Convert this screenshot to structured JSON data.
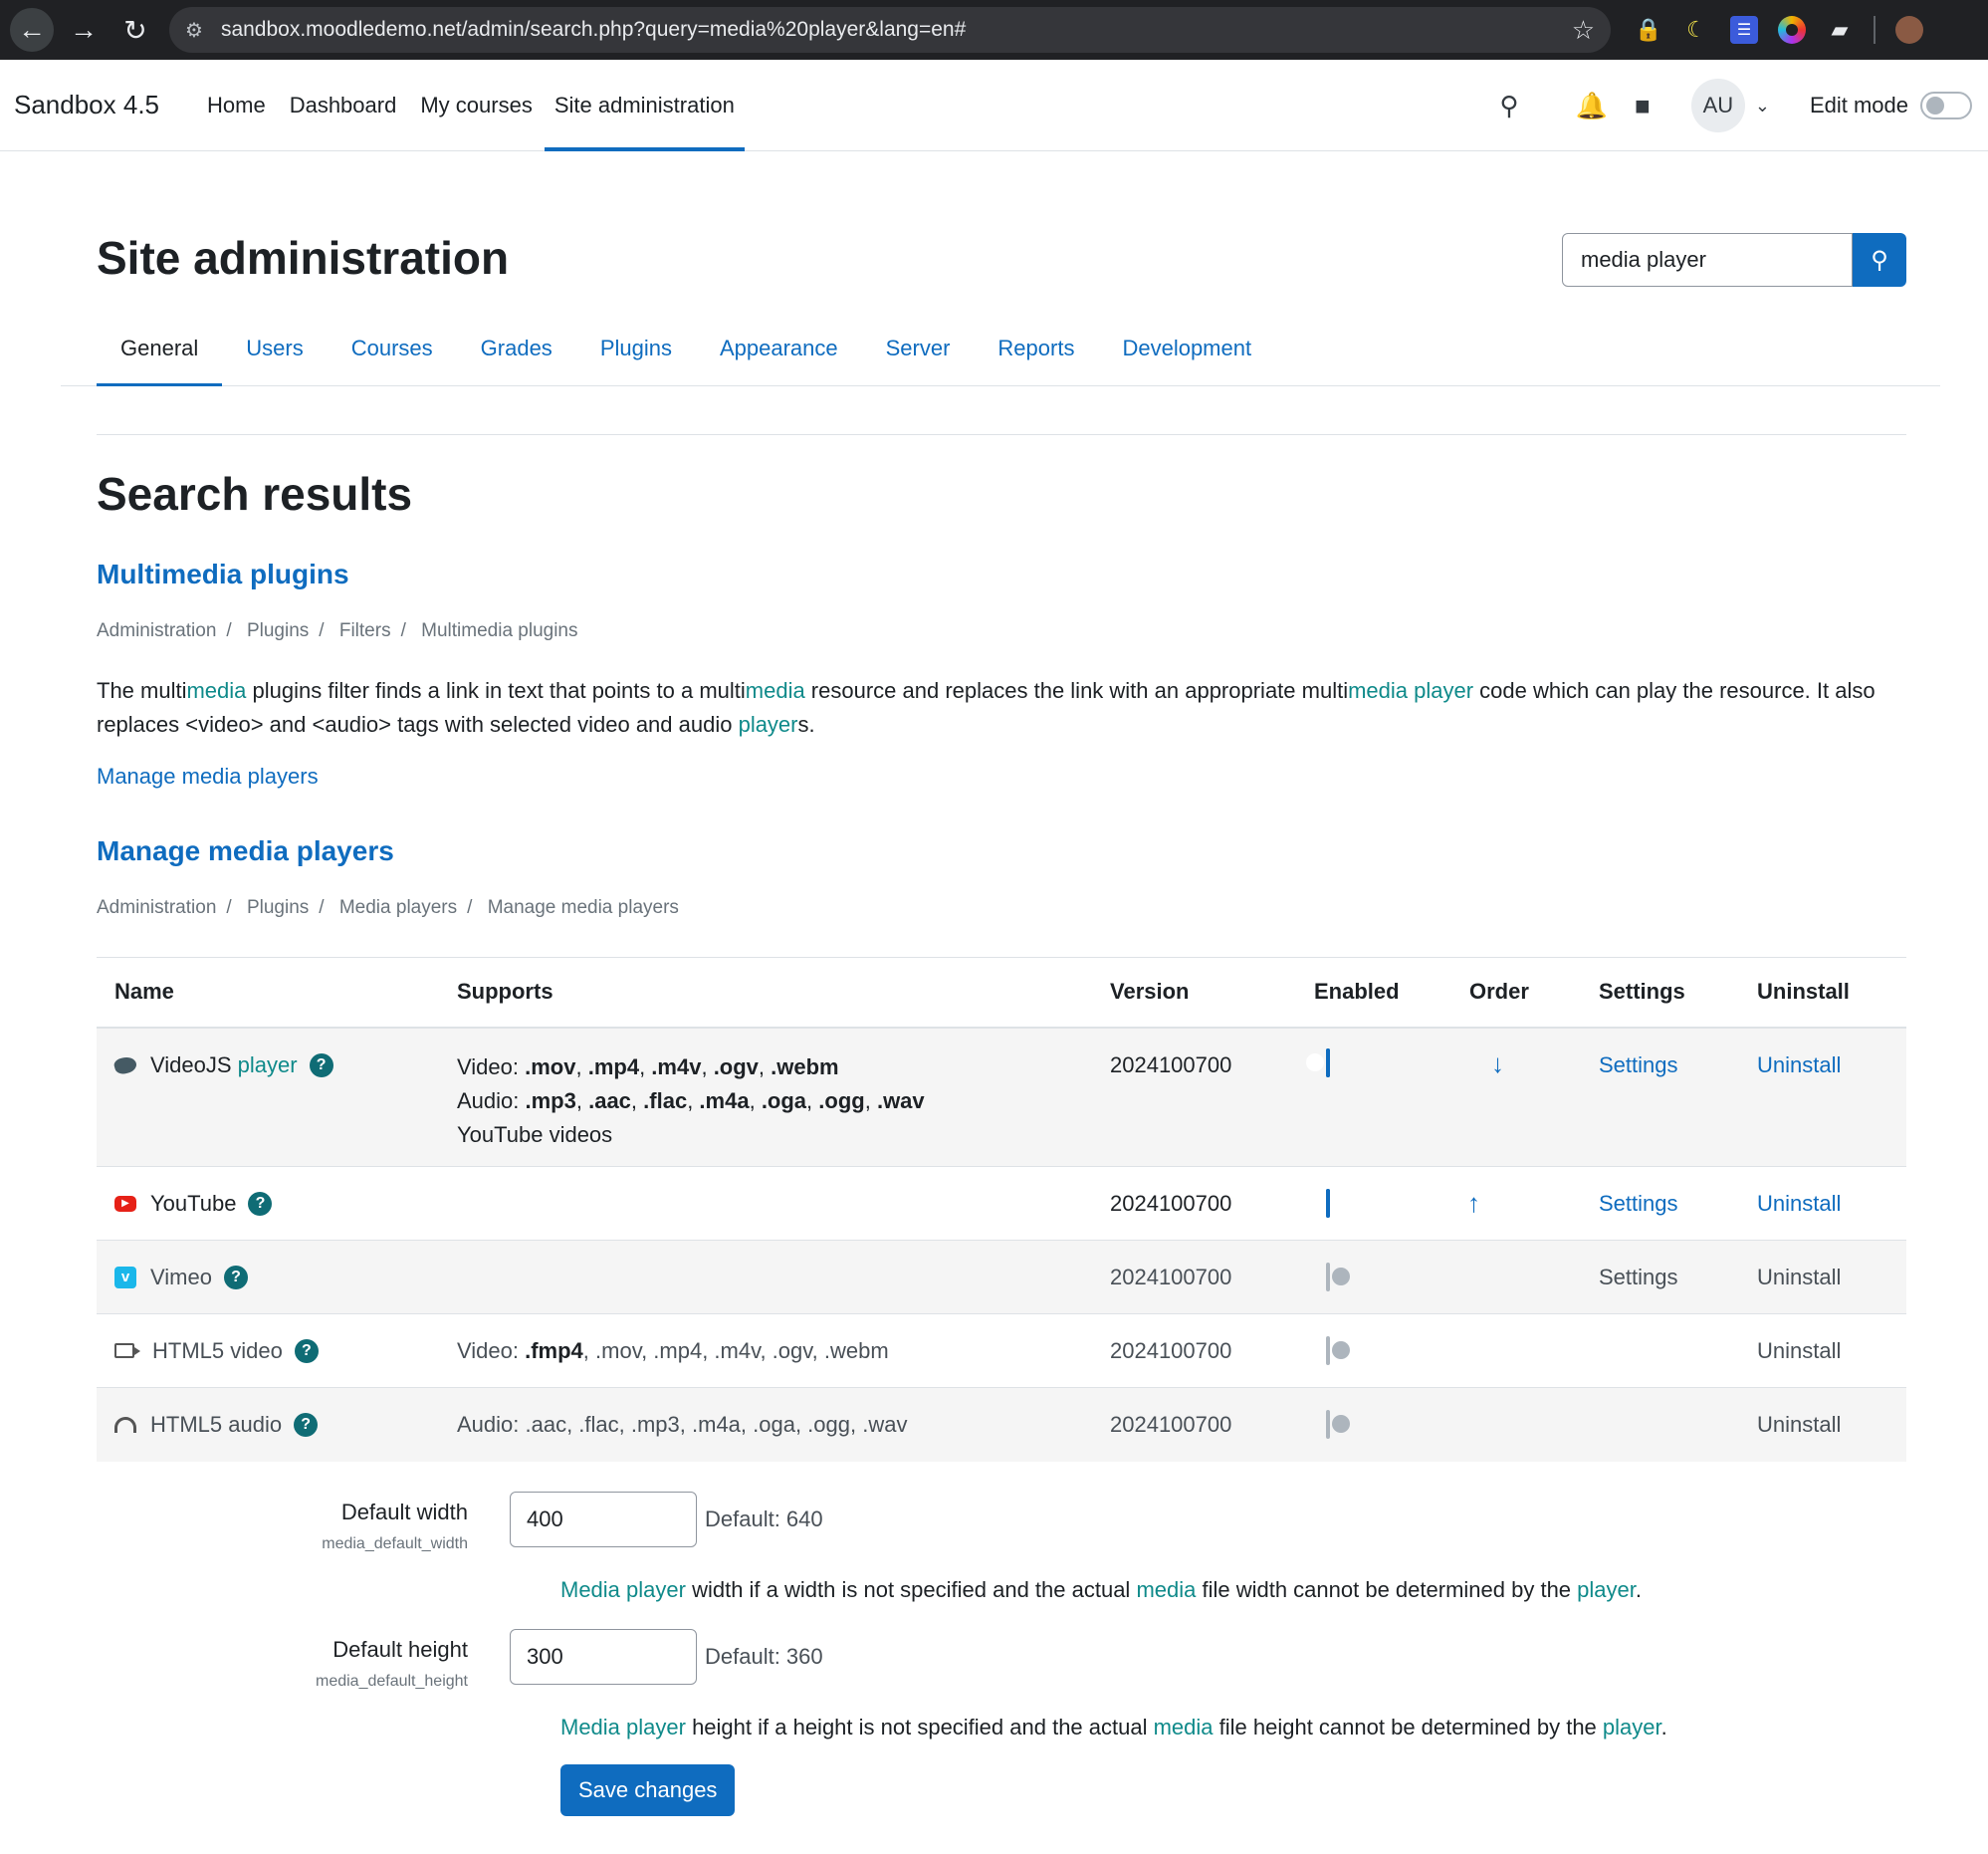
{
  "browser": {
    "url": "sandbox.moodledemo.net/admin/search.php?query=media%20player&lang=en#"
  },
  "navbar": {
    "brand": "Sandbox 4.5",
    "items": [
      "Home",
      "Dashboard",
      "My courses",
      "Site administration"
    ],
    "active_item": "Site administration",
    "user_initials": "AU",
    "edit_mode_label": "Edit mode"
  },
  "page": {
    "title": "Site administration",
    "search_value": "media player",
    "tabs": [
      "General",
      "Users",
      "Courses",
      "Grades",
      "Plugins",
      "Appearance",
      "Server",
      "Reports",
      "Development"
    ],
    "active_tab": "General",
    "results_heading": "Search results"
  },
  "multimedia_section": {
    "heading": "Multimedia plugins",
    "breadcrumb": [
      "Administration",
      "Plugins",
      "Filters",
      "Multimedia plugins"
    ],
    "desc": {
      "t1": "The multi",
      "h1": "media",
      "t2": " plugins filter finds a link in text that points to a multi",
      "h2": "media",
      "t3": " resource and replaces the link with an appropriate multi",
      "h3": "media player",
      "t4": " code which can play the resource. It also replaces <video> and <audio> tags with selected video and audio ",
      "h4": "player",
      "t5": "s."
    },
    "link": "Manage media players"
  },
  "players_section": {
    "heading": "Manage media players",
    "breadcrumb": [
      "Administration",
      "Plugins",
      "Media players",
      "Manage media players"
    ],
    "columns": [
      "Name",
      "Supports",
      "Version",
      "Enabled",
      "Order",
      "Settings",
      "Uninstall"
    ],
    "rows": [
      {
        "name": "VideoJS ",
        "name_hl": "player",
        "icon": "videojs-icon",
        "video_prefix": "Video: ",
        "video_exts": [
          ".mov",
          ".mp4",
          ".m4v",
          ".ogv",
          ".webm"
        ],
        "audio_prefix": "Audio: ",
        "audio_exts": [
          ".mp3",
          ".aac",
          ".flac",
          ".m4a",
          ".oga",
          ".ogg",
          ".wav"
        ],
        "extra": "YouTube videos",
        "version": "2024100700",
        "enabled": true,
        "order": "↓",
        "settings": "Settings",
        "uninstall": "Uninstall"
      },
      {
        "name": "YouTube",
        "icon": "youtube-icon",
        "version": "2024100700",
        "enabled": true,
        "order": "↑",
        "settings": "Settings",
        "uninstall": "Uninstall"
      },
      {
        "name": "Vimeo",
        "icon": "vimeo-icon",
        "version": "2024100700",
        "enabled": false,
        "settings": "Settings",
        "uninstall": "Uninstall"
      },
      {
        "name": "HTML5 video",
        "icon": "video-camera-icon",
        "supports_prefix": "Video: ",
        "supports_bold": ".fmp4",
        "supports_rest": ", .mov, .mp4, .m4v, .ogv, .webm",
        "version": "2024100700",
        "enabled": false,
        "uninstall": "Uninstall"
      },
      {
        "name": "HTML5 audio",
        "icon": "headphones-icon",
        "supports": "Audio: .aac, .flac, .mp3, .m4a, .oga, .ogg, .wav",
        "version": "2024100700",
        "enabled": false,
        "uninstall": "Uninstall"
      }
    ]
  },
  "form": {
    "width": {
      "label": "Default width",
      "key": "media_default_width",
      "value": "400",
      "default": "Default: 640",
      "desc": {
        "h1": "Media player",
        "t1": " width if a width is not specified and the actual ",
        "h2": "media",
        "t2": " file width cannot be determined by the ",
        "h3": "player",
        "t3": "."
      }
    },
    "height": {
      "label": "Default height",
      "key": "media_default_height",
      "value": "300",
      "default": "Default: 360",
      "desc": {
        "h1": "Media player",
        "t1": " height if a height is not specified and the actual ",
        "h2": "media",
        "t2": " file height cannot be determined by the ",
        "h3": "player",
        "t3": "."
      }
    },
    "save_label": "Save changes"
  },
  "colors": {
    "accent": "#0f6cbf",
    "highlight": "#0f8a8a"
  }
}
